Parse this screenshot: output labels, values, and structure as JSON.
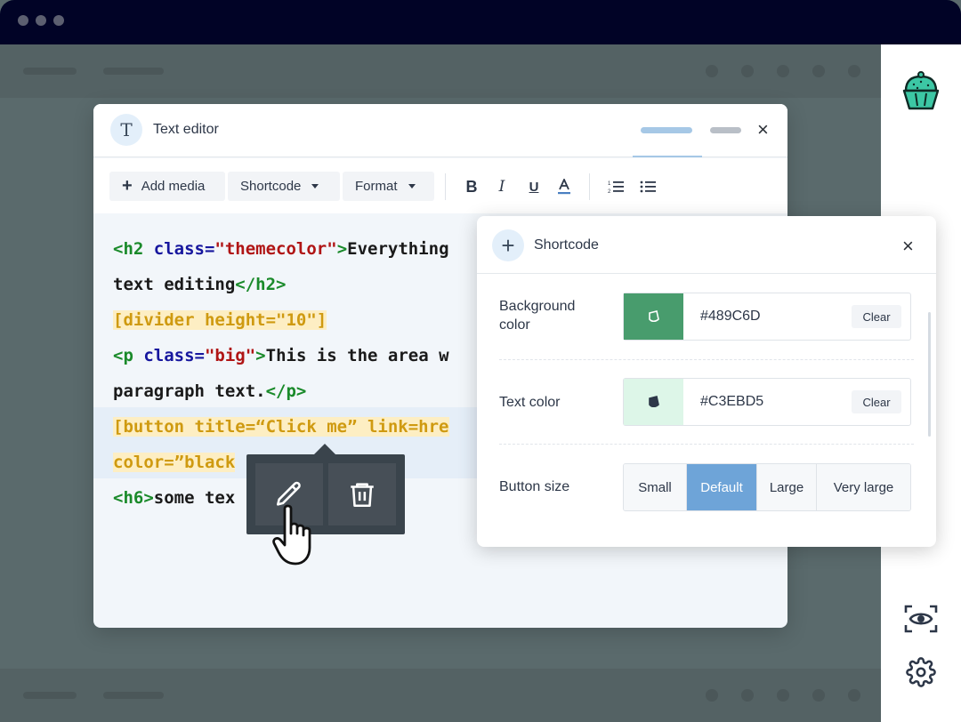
{
  "editor": {
    "avatar_letter": "T",
    "title": "Text editor",
    "toolbar": {
      "add_media": "Add media",
      "shortcode": "Shortcode",
      "format": "Format"
    }
  },
  "code_lines": [
    [
      {
        "t": "<h2 ",
        "c": "tg"
      },
      {
        "t": "class=",
        "c": "at"
      },
      {
        "t": "\"themecolor\"",
        "c": "st"
      },
      {
        "t": ">",
        "c": "tg"
      },
      {
        "t": "Everything",
        "c": ""
      }
    ],
    [
      {
        "t": "text editing",
        "c": ""
      },
      {
        "t": "</h2>",
        "c": "tg"
      }
    ],
    [
      {
        "t": "[divider height=\"10\"]",
        "c": "sc"
      }
    ],
    [
      {
        "t": "<p ",
        "c": "tg"
      },
      {
        "t": "class=",
        "c": "at"
      },
      {
        "t": "\"big\"",
        "c": "st"
      },
      {
        "t": ">",
        "c": "tg"
      },
      {
        "t": "This is the area w",
        "c": ""
      }
    ],
    [
      {
        "t": "paragraph text.",
        "c": ""
      },
      {
        "t": "</p>",
        "c": "tg"
      }
    ],
    [
      {
        "t": "[button title=“Click me” link=hre",
        "c": "sc"
      }
    ],
    [
      {
        "t": "color=”black",
        "c": "sc"
      }
    ],
    [
      {
        "t": "<h6>",
        "c": "tg"
      },
      {
        "t": "some tex",
        "c": ""
      }
    ]
  ],
  "shortcode_panel": {
    "title": "Shortcode",
    "background_color": {
      "label": "Background color",
      "value": "#489C6D",
      "swatch": "#489C6D",
      "clear": "Clear"
    },
    "text_color": {
      "label": "Text color",
      "value": "#C3EBD5",
      "swatch": "#DDF6E8",
      "clear": "Clear"
    },
    "button_size": {
      "label": "Button size",
      "options": [
        "Small",
        "Default",
        "Large",
        "Very large"
      ],
      "selected": "Default"
    }
  },
  "colors": {
    "titlebar": "#010326",
    "accent_blue": "#6EA4D8",
    "cupcake_teal": "#3CC7A4"
  },
  "icons": [
    "cupcake-icon",
    "eye-scan-icon",
    "gear-icon",
    "pencil-icon",
    "trash-icon",
    "hand-pointer-icon"
  ]
}
